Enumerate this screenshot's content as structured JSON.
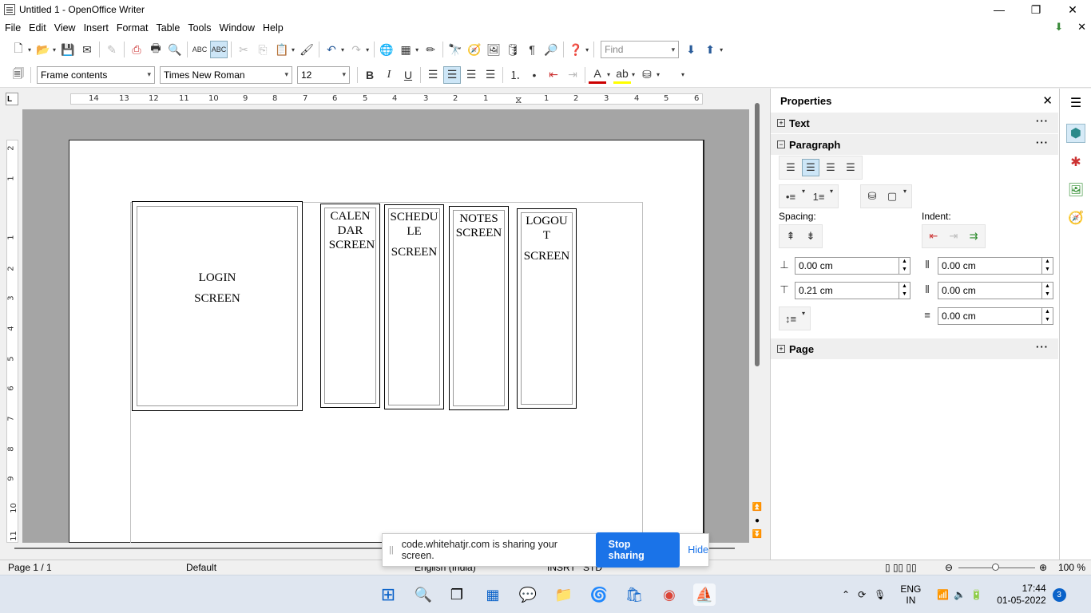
{
  "window": {
    "title": "Untitled 1 - OpenOffice Writer",
    "minimize": "—",
    "restore": "❐",
    "close": "✕"
  },
  "menu": [
    "File",
    "Edit",
    "View",
    "Insert",
    "Format",
    "Table",
    "Tools",
    "Window",
    "Help"
  ],
  "toolbar": {
    "find_placeholder": "Find",
    "style": "Frame contents",
    "font": "Times New Roman",
    "size": "12"
  },
  "ruler": {
    "h_labels": [
      "14",
      "13",
      "12",
      "11",
      "10",
      "9",
      "8",
      "7",
      "6",
      "5",
      "4",
      "3",
      "2",
      "1",
      "1",
      "2",
      "3",
      "4",
      "5",
      "6"
    ],
    "v_labels": [
      "2",
      "1",
      "1",
      "2",
      "3",
      "4",
      "5",
      "6",
      "7",
      "8",
      "9",
      "10",
      "11"
    ],
    "corner": "L"
  },
  "document": {
    "frames": [
      {
        "lines": [
          "LOGIN",
          "SCREEN"
        ]
      },
      {
        "lines": [
          "CALEN",
          "DAR",
          "SCREEN"
        ]
      },
      {
        "lines": [
          "SCHEDU",
          "LE",
          "",
          "SCREEN"
        ]
      },
      {
        "lines": [
          "NOTES",
          "SCREEN"
        ]
      },
      {
        "lines": [
          "LOGOU",
          "T",
          "",
          "SCREEN"
        ]
      }
    ]
  },
  "sidebar": {
    "title": "Properties",
    "sections": {
      "text": "Text",
      "paragraph": "Paragraph",
      "page": "Page"
    },
    "spacing_label": "Spacing:",
    "indent_label": "Indent:",
    "above_spacing": "0.00 cm",
    "below_spacing": "0.21 cm",
    "before_indent": "0.00 cm",
    "after_indent": "0.00 cm",
    "first_line_indent": "0.00 cm"
  },
  "status": {
    "page": "Page 1 / 1",
    "style": "Default",
    "language": "English (India)",
    "insert": "INSRT",
    "selection": "STD",
    "zoom": "100 %"
  },
  "share": {
    "message": "code.whitehatjr.com is sharing your screen.",
    "stop": "Stop sharing",
    "hide": "Hide"
  },
  "taskbar": {
    "lang_top": "ENG",
    "lang_bottom": "IN",
    "time": "17:44",
    "date": "01-05-2022",
    "notifications": "3"
  }
}
